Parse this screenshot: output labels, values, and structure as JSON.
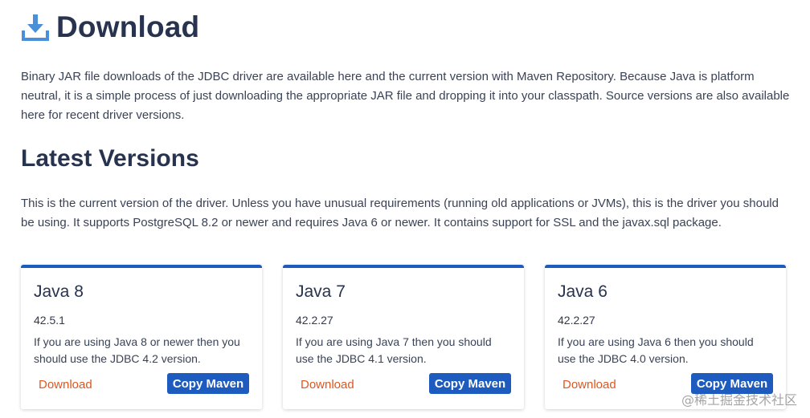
{
  "header": {
    "title": "Download",
    "icon": "download-icon"
  },
  "intro": {
    "text": "Binary JAR file downloads of the JDBC driver are available here and the current version with Maven Repository. Because Java is platform neutral, it is a simple process of just downloading the appropriate JAR file and dropping it into your classpath. Source versions are also available here for recent driver versions."
  },
  "latest": {
    "title": "Latest Versions",
    "text": "This is the current version of the driver. Unless you have unusual requirements (running old applications or JVMs), this is the driver you should be using. It supports PostgreSQL 8.2 or newer and requires Java 6 or newer. It contains support for SSL and the javax.sql package."
  },
  "cards": [
    {
      "title": "Java 8",
      "version": "42.5.1",
      "text": "If you are using Java 8 or newer then you should use the JDBC 4.2 version.",
      "download_label": "Download",
      "maven_label": "Copy Maven"
    },
    {
      "title": "Java 7",
      "version": "42.2.27",
      "text": "If you are using Java 7 then you should use the JDBC 4.1 version.",
      "download_label": "Download",
      "maven_label": "Copy Maven"
    },
    {
      "title": "Java 6",
      "version": "42.2.27",
      "text": "If you are using Java 6 then you should use the JDBC 4.0 version.",
      "download_label": "Download",
      "maven_label": "Copy Maven"
    }
  ],
  "watermark": "@稀土掘金技术社区",
  "colors": {
    "accent": "#1e5bbf",
    "link": "#e0561f",
    "heading": "#27334f",
    "icon": "#4a90d9"
  }
}
